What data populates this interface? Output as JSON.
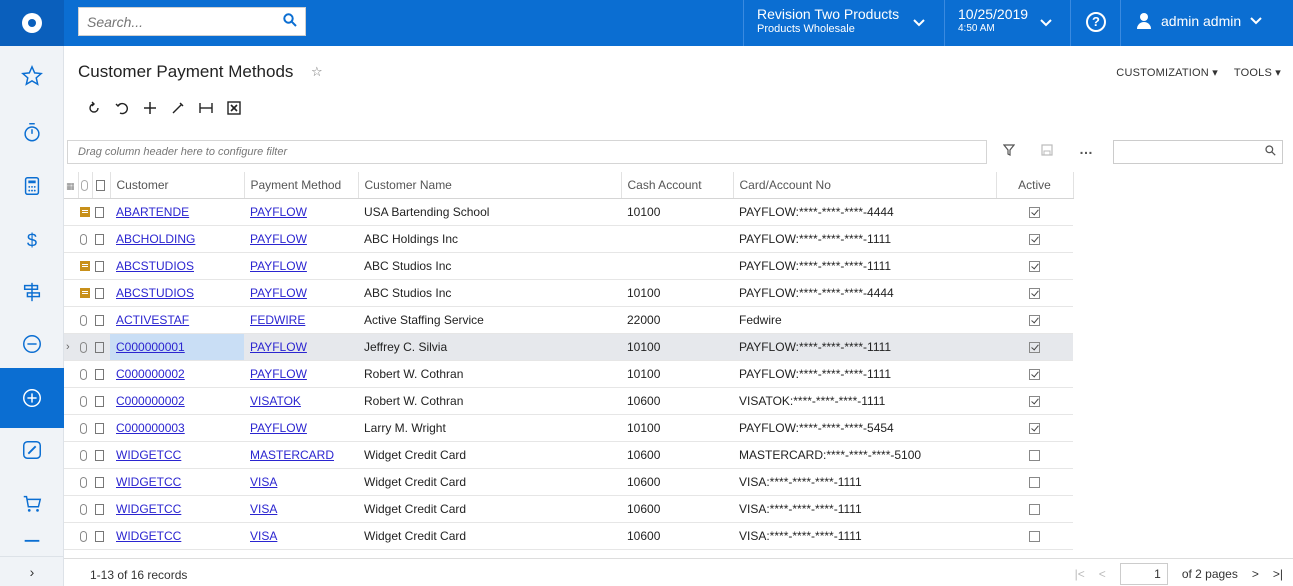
{
  "header": {
    "search_placeholder": "Search...",
    "branch_line1": "Revision Two Products",
    "branch_line2": "Products Wholesale",
    "date": "10/25/2019",
    "time": "4:50 AM",
    "help": "?",
    "user": "admin admin"
  },
  "page": {
    "title": "Customer Payment Methods",
    "customization": "CUSTOMIZATION",
    "tools": "TOOLS"
  },
  "grid": {
    "filter_placeholder": "Drag column header here to configure filter",
    "columns": [
      "Customer",
      "Payment Method",
      "Customer Name",
      "Cash Account",
      "Card/Account No",
      "Active"
    ],
    "rows": [
      {
        "icon": "note",
        "customer": "ABARTENDE",
        "method": "PAYFLOW",
        "name": "USA Bartending School",
        "cash": "10100",
        "card": "PAYFLOW:****-****-****-4444",
        "active": true
      },
      {
        "icon": "attach",
        "customer": "ABCHOLDING",
        "method": "PAYFLOW",
        "name": "ABC Holdings Inc",
        "cash": "",
        "card": "PAYFLOW:****-****-****-1111",
        "active": true
      },
      {
        "icon": "note",
        "customer": "ABCSTUDIOS",
        "method": "PAYFLOW",
        "name": "ABC Studios Inc",
        "cash": "",
        "card": "PAYFLOW:****-****-****-1111",
        "active": true
      },
      {
        "icon": "note",
        "customer": "ABCSTUDIOS",
        "method": "PAYFLOW",
        "name": "ABC Studios Inc",
        "cash": "10100",
        "card": "PAYFLOW:****-****-****-4444",
        "active": true
      },
      {
        "icon": "attach",
        "customer": "ACTIVESTAF",
        "method": "FEDWIRE",
        "name": "Active Staffing Service",
        "cash": "22000",
        "card": "Fedwire",
        "active": true
      },
      {
        "icon": "attach",
        "customer": "C000000001",
        "method": "PAYFLOW",
        "name": "Jeffrey C. Silvia",
        "cash": "10100",
        "card": "PAYFLOW:****-****-****-1111",
        "active": true,
        "selected": true
      },
      {
        "icon": "attach",
        "customer": "C000000002",
        "method": "PAYFLOW",
        "name": "Robert W. Cothran",
        "cash": "10100",
        "card": "PAYFLOW:****-****-****-1111",
        "active": true
      },
      {
        "icon": "attach",
        "customer": "C000000002",
        "method": "VISATOK",
        "name": "Robert W. Cothran",
        "cash": "10600",
        "card": "VISATOK:****-****-****-1111",
        "active": true
      },
      {
        "icon": "attach",
        "customer": "C000000003",
        "method": "PAYFLOW",
        "name": "Larry M. Wright",
        "cash": "10100",
        "card": "PAYFLOW:****-****-****-5454",
        "active": true
      },
      {
        "icon": "attach",
        "customer": "WIDGETCC",
        "method": "MASTERCARD",
        "name": "Widget Credit Card",
        "cash": "10600",
        "card": "MASTERCARD:****-****-****-5100",
        "active": false
      },
      {
        "icon": "attach",
        "customer": "WIDGETCC",
        "method": "VISA",
        "name": "Widget Credit Card",
        "cash": "10600",
        "card": "VISA:****-****-****-1111",
        "active": false
      },
      {
        "icon": "attach",
        "customer": "WIDGETCC",
        "method": "VISA",
        "name": "Widget Credit Card",
        "cash": "10600",
        "card": "VISA:****-****-****-1111",
        "active": false
      },
      {
        "icon": "attach",
        "customer": "WIDGETCC",
        "method": "VISA",
        "name": "Widget Credit Card",
        "cash": "10600",
        "card": "VISA:****-****-****-1111",
        "active": false
      }
    ]
  },
  "footer": {
    "records": "1-13 of 16 records",
    "page": "1",
    "of_pages": "of 2 pages"
  }
}
